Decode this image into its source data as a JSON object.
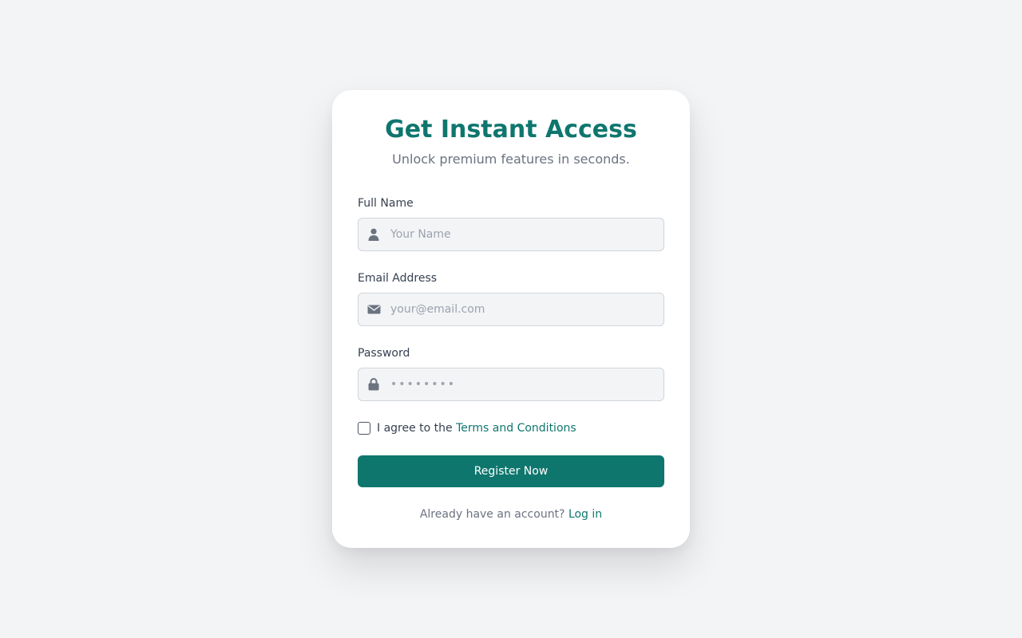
{
  "card": {
    "title": "Get Instant Access",
    "subtitle": "Unlock premium features in seconds."
  },
  "form": {
    "full_name": {
      "label": "Full Name",
      "placeholder": "Your Name",
      "value": "",
      "icon": "user-icon"
    },
    "email": {
      "label": "Email Address",
      "placeholder": "your@email.com",
      "value": "",
      "icon": "envelope-icon"
    },
    "password": {
      "label": "Password",
      "placeholder": "••••••••",
      "value": "",
      "icon": "lock-icon"
    },
    "terms": {
      "checked": false,
      "prefix": "I agree to the ",
      "link_label": "Terms and Conditions"
    },
    "submit_label": "Register Now"
  },
  "footer": {
    "prompt": "Already have an account? ",
    "login_label": "Log in"
  },
  "colors": {
    "accent": "#0f766e",
    "background": "#f3f4f6",
    "card": "#ffffff",
    "input_bg": "#f3f4f6",
    "muted_text": "#6b7280",
    "icon": "#6b7280"
  }
}
